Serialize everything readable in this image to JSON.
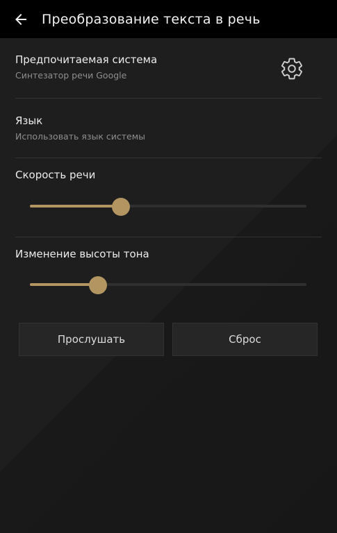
{
  "appbar": {
    "title": "Преобразование текста в речь",
    "back_icon": "arrow-left-icon"
  },
  "preferred_engine": {
    "title": "Предпочитаемая система",
    "summary": "Синтезатор речи Google",
    "settings_icon": "gear-icon"
  },
  "language": {
    "title": "Язык",
    "summary": "Использовать язык системы"
  },
  "speech_rate": {
    "title": "Скорость речи",
    "value_fraction": 0.33
  },
  "pitch": {
    "title": "Изменение высоты тона",
    "value_fraction": 0.245
  },
  "buttons": {
    "listen": "Прослушать",
    "reset": "Сброс"
  },
  "colors": {
    "accent": "#b39562",
    "background": "#1c1c1c",
    "appbar": "#000000"
  }
}
